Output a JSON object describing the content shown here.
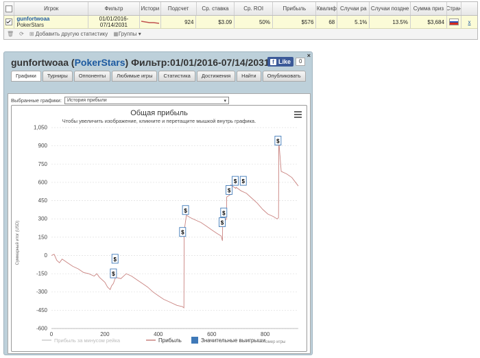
{
  "table": {
    "headers": [
      "Игрок",
      "Фильтр",
      "Истори",
      "Подсчет",
      "Ср. ставка",
      "Ср. ROI",
      "Прибыль",
      "Квалиф",
      "Случаи ра",
      "Случаи поздне",
      "Сумма приз",
      "Стран"
    ],
    "row": {
      "player_name": "gunfortwoaa",
      "room": "PokerStars",
      "filter_line1": "01/01/2016-",
      "filter_line2": "07/14/2031",
      "count": "924",
      "avg_stake": "$3.09",
      "avg_roi": "50%",
      "profit": "$576",
      "qualif": "68",
      "early": "5.1%",
      "late": "13.5%",
      "prize_sum": "$3,684",
      "remove": "x"
    },
    "toolbar": {
      "add_label": "Добавить другую статистику",
      "groups_label": "Группы"
    }
  },
  "panel": {
    "player": "gunfortwoaa",
    "site": "PokerStars",
    "filter_text": "Фильтр:01/01/2016-07/14/2031",
    "fb_like": "Like",
    "fb_count": "0",
    "close": "×",
    "tabs": [
      "Графики",
      "Турниры",
      "Оппоненты",
      "Любимые игры",
      "Статистика",
      "Достижения",
      "Найти",
      "Опубликовать"
    ],
    "selected_label": "Выбранные графики:",
    "selected_value": "История прибыли"
  },
  "chart_data": {
    "type": "line",
    "title": "Общая прибыль",
    "subtitle": "Чтобы увеличить изображение, кликните и перетащите мышкой внутрь графика.",
    "xlabel": "Номер игры",
    "ylabel": "Суммарный итог (USD)",
    "xlim": [
      0,
      924
    ],
    "ylim": [
      -600,
      1050
    ],
    "xticks": [
      0,
      200,
      400,
      600,
      800
    ],
    "yticks": [
      -600,
      -450,
      -300,
      -150,
      0,
      150,
      300,
      450,
      600,
      750,
      900,
      1050
    ],
    "legend": [
      "Прибыль за минусом рейка",
      "Прибыль",
      "Значительные выигрыши"
    ],
    "series": [
      {
        "name": "Прибыль",
        "color": "#c9827f",
        "x": [
          0,
          10,
          20,
          30,
          40,
          60,
          80,
          100,
          120,
          140,
          160,
          170,
          180,
          200,
          210,
          215,
          220,
          225,
          232,
          240,
          260,
          280,
          300,
          320,
          340,
          360,
          380,
          400,
          420,
          440,
          470,
          490,
          496,
          497,
          505,
          520,
          540,
          560,
          580,
          600,
          620,
          635,
          640,
          641,
          655,
          656,
          670,
          671,
          690,
          691,
          710,
          730,
          750,
          770,
          790,
          810,
          830,
          845,
          850,
          851,
          860,
          880,
          900,
          924
        ],
        "y": [
          0,
          10,
          -40,
          -60,
          -30,
          -60,
          -90,
          -110,
          -140,
          -150,
          -170,
          -150,
          -180,
          -220,
          -260,
          -270,
          -280,
          -250,
          -230,
          -180,
          -190,
          -150,
          -170,
          -200,
          -230,
          -260,
          -300,
          -330,
          -360,
          -380,
          -410,
          -420,
          -430,
          200,
          330,
          310,
          290,
          270,
          240,
          210,
          180,
          160,
          120,
          260,
          300,
          480,
          500,
          580,
          550,
          560,
          530,
          510,
          470,
          430,
          380,
          340,
          320,
          300,
          310,
          940,
          690,
          670,
          640,
          570
        ]
      }
    ],
    "big_wins": [
      {
        "x": 232,
        "y": -150
      },
      {
        "x": 238,
        "y": -30
      },
      {
        "x": 491,
        "y": 190
      },
      {
        "x": 502,
        "y": 370
      },
      {
        "x": 639,
        "y": 270
      },
      {
        "x": 645,
        "y": 350
      },
      {
        "x": 665,
        "y": 535
      },
      {
        "x": 688,
        "y": 610
      },
      {
        "x": 718,
        "y": 610
      },
      {
        "x": 848,
        "y": 940
      }
    ]
  }
}
